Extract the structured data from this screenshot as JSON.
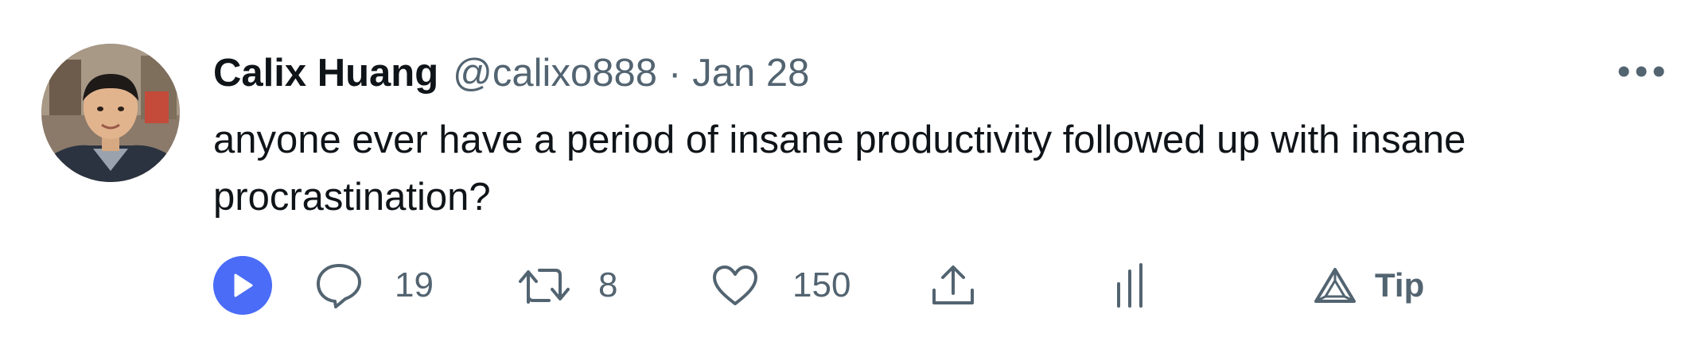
{
  "tweet": {
    "author": {
      "display_name": "Calix Huang",
      "handle": "@calixo888",
      "avatar_icon": "profile-photo"
    },
    "separator": "·",
    "date": "Jan 28",
    "text": "anyone ever have a period of insane productivity followed up with insane procrastination?",
    "menu_icon": "more-horizontal-icon"
  },
  "actions": {
    "play": {
      "icon": "play-icon",
      "color": "#4a6cf7"
    },
    "reply": {
      "icon": "reply-icon",
      "count": "19"
    },
    "retweet": {
      "icon": "retweet-icon",
      "count": "8"
    },
    "like": {
      "icon": "heart-icon",
      "count": "150"
    },
    "share": {
      "icon": "share-icon"
    },
    "analytics": {
      "icon": "analytics-icon"
    },
    "tip": {
      "icon": "tip-icon",
      "label": "Tip"
    }
  },
  "colors": {
    "text_primary": "#0f1419",
    "text_secondary": "#536471",
    "accent": "#4a6cf7"
  }
}
